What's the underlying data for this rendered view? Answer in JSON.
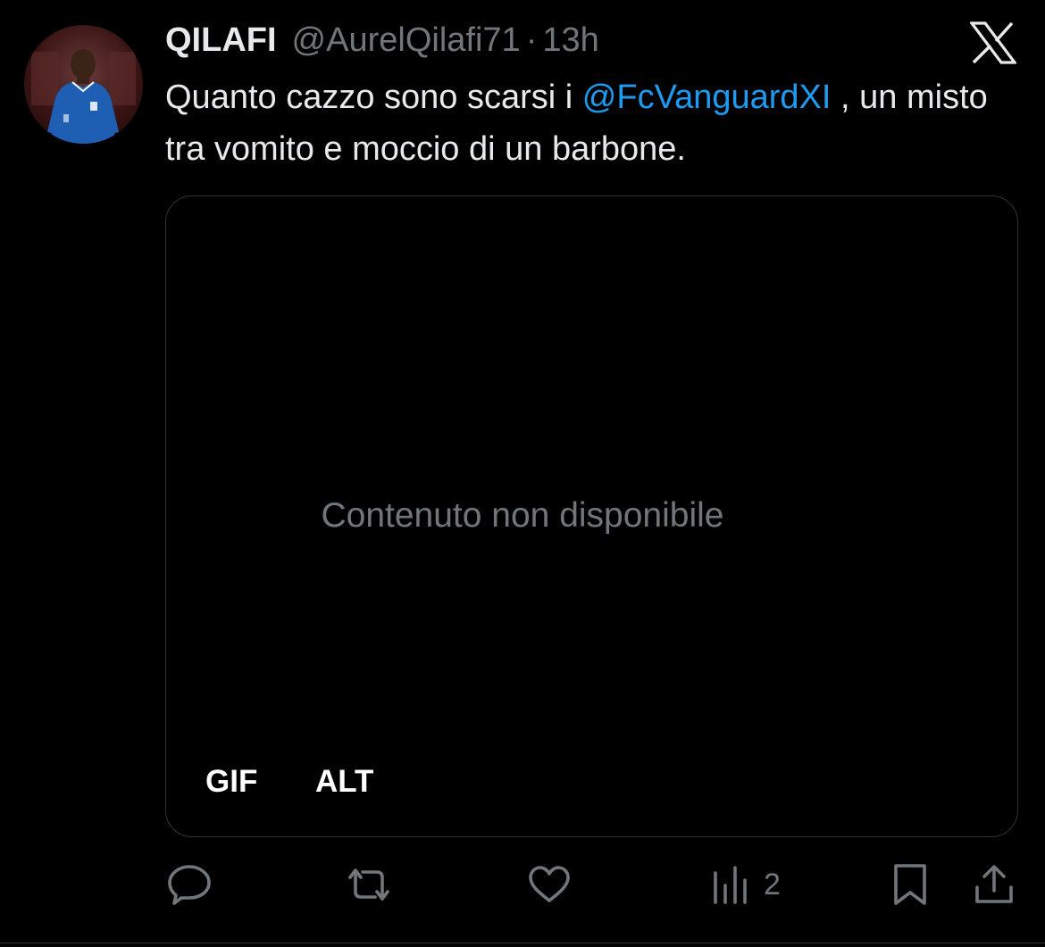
{
  "tweet": {
    "display_name": "QILAFI",
    "handle": "@AurelQilafi71",
    "separator": "·",
    "timestamp": "13h",
    "text_before": "Quanto cazzo sono scarsi i ",
    "mention": "@FcVanguardXI",
    "text_after": " , un misto tra vomito e moccio di un barbone.",
    "avatar_icon": "player-photo-avatar"
  },
  "media": {
    "unavailable_text": "Contenuto non disponibile",
    "badge_gif": "GIF",
    "badge_alt": "ALT"
  },
  "actions": {
    "reply_icon": "reply-icon",
    "retweet_icon": "retweet-icon",
    "like_icon": "heart-icon",
    "views_icon": "views-chart-icon",
    "views_count": "2",
    "bookmark_icon": "bookmark-icon",
    "share_icon": "share-icon"
  },
  "colors": {
    "background": "#000000",
    "text_primary": "#e7e9ea",
    "text_secondary": "#71767b",
    "accent": "#1d9bf0",
    "border": "#2f3336"
  }
}
